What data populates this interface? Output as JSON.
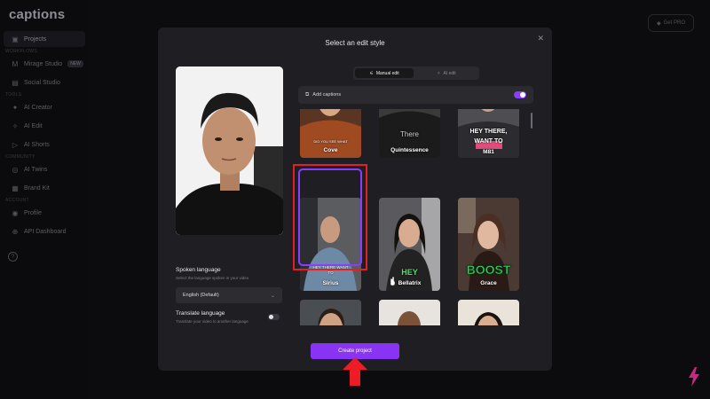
{
  "app": {
    "logo": "captions",
    "pro_button": "Get PRO"
  },
  "sidebar": {
    "groups": {
      "workflows": "WORKFLOWS",
      "tools": "TOOLS",
      "community": "COMMUNITY",
      "account": "ACCOUNT"
    },
    "items": [
      {
        "label": "Projects",
        "icon": "projects-icon"
      },
      {
        "label": "Mirage Studio",
        "icon": "mirage-icon",
        "badge": "NEW"
      },
      {
        "label": "Social Studio",
        "icon": "social-icon"
      },
      {
        "label": "AI Creator",
        "icon": "creator-icon"
      },
      {
        "label": "AI Edit",
        "icon": "edit-icon"
      },
      {
        "label": "AI Shorts",
        "icon": "shorts-icon"
      },
      {
        "label": "AI Twins",
        "icon": "twins-icon"
      },
      {
        "label": "Brand Kit",
        "icon": "brand-icon"
      },
      {
        "label": "Profile",
        "icon": "profile-icon"
      },
      {
        "label": "API Dashboard",
        "icon": "api-icon"
      }
    ]
  },
  "modal": {
    "title": "Select an edit style",
    "tabs": {
      "manual": "Manual edit",
      "ai": "AI edit"
    },
    "add_captions": "Add captions",
    "add_captions_enabled": true,
    "spoken_language": {
      "label": "Spoken language",
      "description": "Select the language spoken in your video",
      "value": "English (Default)"
    },
    "translate": {
      "label": "Translate language",
      "description": "Translate your video to another language",
      "enabled": false
    },
    "create_button": "Create project"
  },
  "styles": [
    {
      "name": "Cove",
      "caption": "DID YOU SEE WHAT"
    },
    {
      "name": "Quintessence",
      "caption": "There"
    },
    {
      "name": "M81",
      "caption": "HEY THERE, WANT TO"
    },
    {
      "name": "Sirius",
      "caption": "HEY THERE WANT TO",
      "selected": true
    },
    {
      "name": "Bellatrix",
      "caption": "HEY"
    },
    {
      "name": "Grace",
      "caption": "BOOST"
    },
    {
      "name": "",
      "caption": ""
    },
    {
      "name": "",
      "caption": ""
    },
    {
      "name": "",
      "caption": ""
    }
  ],
  "colors": {
    "accent": "#8933f4",
    "highlight": "#e31f26",
    "grace_text": "#2fd35a",
    "bellatrix_text": "#4ee26b",
    "m81_highlight": "#e04d7c"
  }
}
